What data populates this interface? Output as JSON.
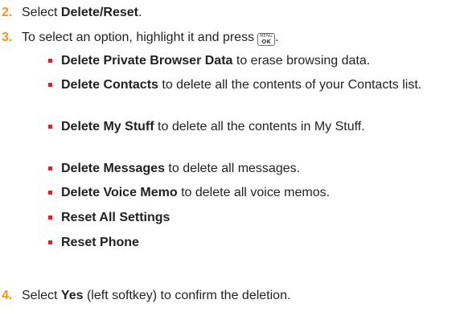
{
  "steps": [
    {
      "number": "2.",
      "pre": "Select ",
      "bold": "Delete/Reset",
      "post": "."
    },
    {
      "number": "3.",
      "text": "To select an option, highlight it and press",
      "end": "."
    },
    {
      "number": "4.",
      "pre": "Select ",
      "bold": "Yes",
      "post": " (left softkey) to confirm the deletion."
    }
  ],
  "key_icon": {
    "name": "menu-ok-key-icon",
    "top_label": "MENU",
    "bottom_label": "OK"
  },
  "options": [
    {
      "bold": "Delete Private Browser Data",
      "text": " to erase browsing data."
    },
    {
      "bold": "Delete Contacts",
      "text": " to delete all the contents of your Contacts list."
    },
    {
      "bold": "Delete My Stuff",
      "text": " to delete all the contents in My Stuff."
    },
    {
      "bold": "Delete Messages",
      "text": " to delete all messages."
    },
    {
      "bold": "Delete Voice Memo",
      "text": " to delete all voice memos."
    },
    {
      "bold": "Reset All Settings",
      "text": ""
    },
    {
      "bold": "Reset Phone",
      "text": ""
    }
  ],
  "colors": {
    "step_number": "#f7941d",
    "bullet": "#ed1c24",
    "text": "#231f20"
  }
}
